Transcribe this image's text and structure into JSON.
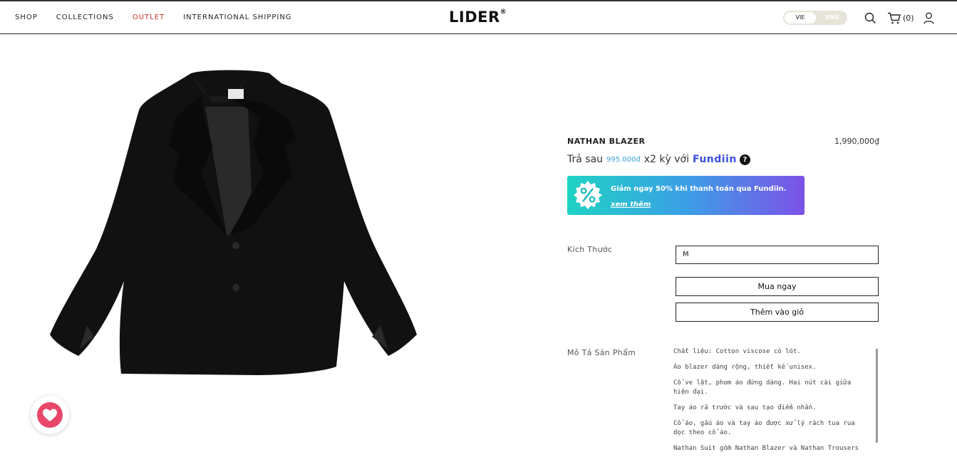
{
  "nav": {
    "links": [
      {
        "label": "SHOP"
      },
      {
        "label": "COLLECTIONS"
      },
      {
        "label": "OUTLET"
      },
      {
        "label": "INTERNATIONAL SHIPPING"
      }
    ]
  },
  "brand": {
    "logo": "LIDER",
    "mark": "®"
  },
  "language": {
    "options": [
      "VIE",
      "ENG"
    ],
    "selected": "VIE"
  },
  "icons": {
    "search": "search-icon",
    "cart": "cart-icon",
    "user": "user-icon",
    "wishlist": "heart-icon"
  },
  "cart": {
    "count": "(0)"
  },
  "product": {
    "name": "NATHAN BLAZER",
    "price": "1,990,000₫",
    "image": "black-blazer-product-photo"
  },
  "bnpl": {
    "prefix": "Trả sau",
    "amount": "995.000đ",
    "suffix": "x2 kỳ với",
    "provider": "Fundiin",
    "help": "?"
  },
  "promo": {
    "text": "Giảm ngay 50% khi thanh toán qua Fundiin.",
    "link": "xem thêm"
  },
  "size": {
    "label": "Kích Thước",
    "value": "M"
  },
  "actions": {
    "buy_now": "Mua ngay",
    "add_to_cart": "Thêm vào giỏ"
  },
  "description": {
    "label": "Mô Tả Sản Phẩm",
    "paragraphs": [
      "Chất liệu: Cotton viscose có lót.",
      "Áo blazer dáng rộng, thiết kế unisex.",
      "Cổ ve lật, phom áo đứng dáng. Hai nút cài giữa hiện đại.",
      "Tay áo rã trước và sau tạo điểm nhấn.",
      "Cổ áo, gấu áo và tay áo được xử lý rách tua rua dọc theo cổ áo.",
      "Nathan Suit gồm Nathan Blazer và Nathan Trousers"
    ]
  },
  "colors": {
    "outlet": "#d0322b",
    "bnpl_amount": "#3aa4d8",
    "promo_gradient_start": "#1fd2c4",
    "promo_gradient_end": "#7d52e8",
    "wishlist": "#e8476a"
  }
}
